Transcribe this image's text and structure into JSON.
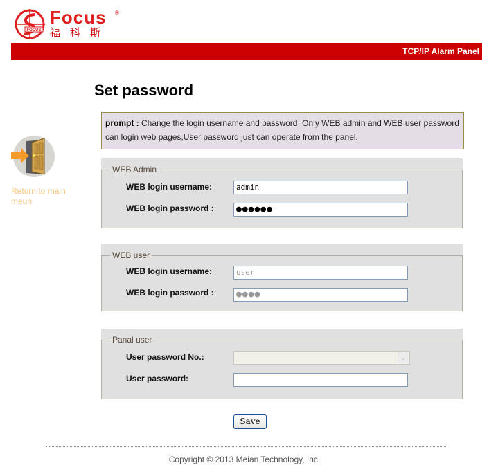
{
  "header": {
    "logo_word": "Focus",
    "logo_reg": "®",
    "logo_cn": "福科斯",
    "bar_title": "TCP/IP Alarm Panel",
    "brand_color": "#cc0000"
  },
  "sidebar": {
    "icon": "exit-door-icon",
    "return_link": "Return to main meun"
  },
  "page": {
    "title": "Set password"
  },
  "prompt": {
    "label": "prompt :",
    "text": " Change the login username and password ,Only WEB admin and WEB user password can login web pages,User password just can operate from the panel."
  },
  "web_admin": {
    "legend": "WEB Admin",
    "username_label": "WEB login username:",
    "username_value": "admin",
    "password_label": "WEB login password :",
    "password_value": "●●●●●●"
  },
  "web_user": {
    "legend": "WEB user",
    "username_label": "WEB login username:",
    "username_value": "user",
    "password_label": "WEB login password :",
    "password_value": "●●●●"
  },
  "panel_user": {
    "legend": "Panal user",
    "number_label": "User password No.:",
    "number_value": "",
    "password_label": "User password:",
    "password_value": ""
  },
  "actions": {
    "save_label": "Save"
  },
  "footer": {
    "copyright": "Copyright © 2013 Meian Technology, Inc."
  }
}
